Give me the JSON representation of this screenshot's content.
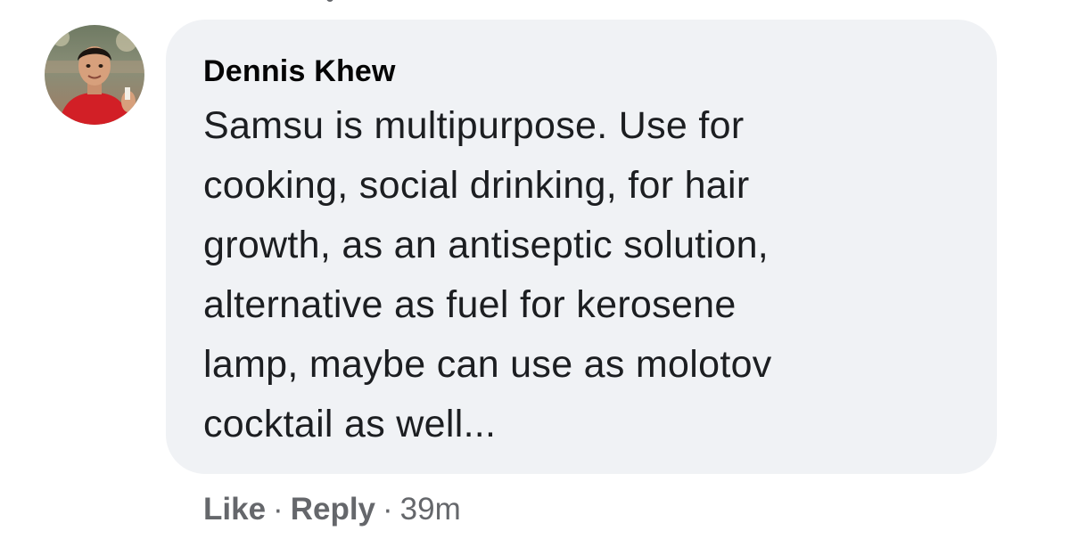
{
  "colors": {
    "bubble_bg": "#f0f2f5",
    "author": "#050505",
    "text": "#1c1e21",
    "meta": "#65676b"
  },
  "comment": {
    "author": "Dennis Khew",
    "avatar_icon": "user-photo-avatar",
    "text_lines": [
      "Samsu is multipurpose. Use for",
      "cooking, social drinking, for hair",
      "growth, as an antiseptic solution,",
      "alternative as fuel for kerosene",
      "lamp, maybe can use as molotov",
      "cocktail as well..."
    ]
  },
  "actions": {
    "like_label": "Like",
    "separator": "·",
    "reply_label": "Reply",
    "timestamp": "39m"
  }
}
